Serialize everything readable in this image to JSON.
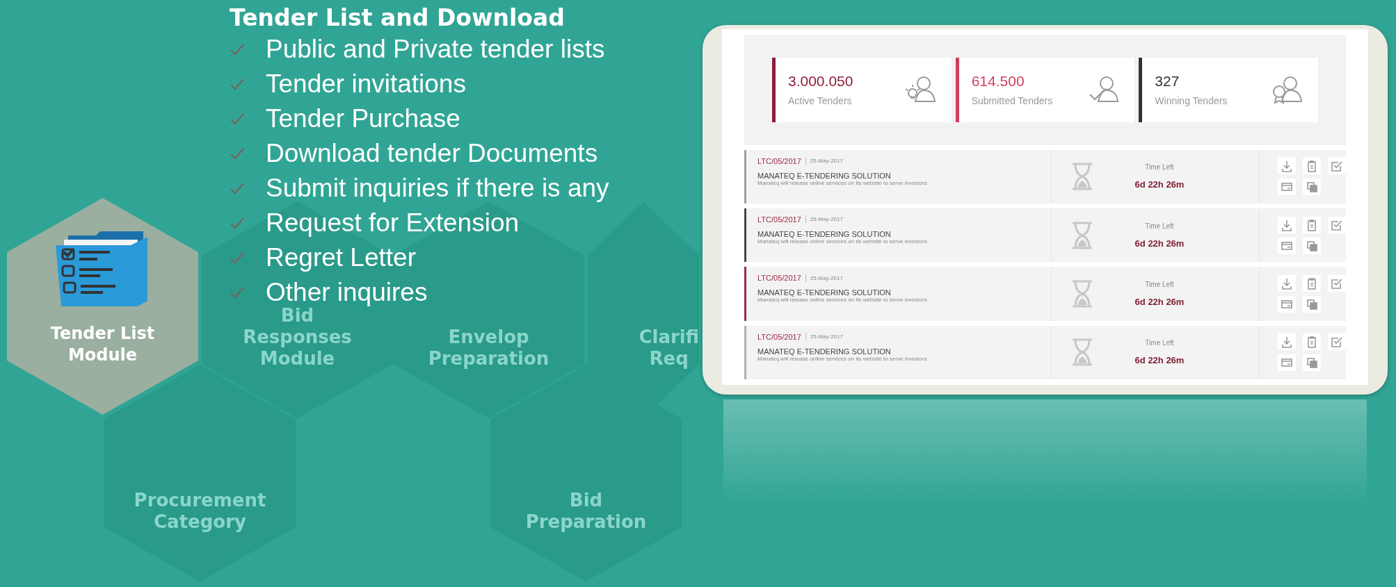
{
  "slide": {
    "heading": "Tender List and Download",
    "features": [
      "Public and Private tender lists",
      "Tender invitations",
      "Tender Purchase",
      "Download tender Documents",
      "Submit inquiries if there is any",
      "Request for Extension",
      "Regret Letter",
      "Other inquires"
    ]
  },
  "modules": [
    {
      "lines": [
        "Tender List",
        "Module"
      ],
      "selected": true
    },
    {
      "lines": [
        "Bid",
        "Responses",
        "Module"
      ],
      "selected": false
    },
    {
      "lines": [
        "Envelop",
        "Preparation"
      ],
      "selected": false
    },
    {
      "lines": [
        "Clarifi",
        "Req"
      ],
      "selected": false
    },
    {
      "lines": [
        "Procurement",
        "Category"
      ],
      "selected": false
    },
    {
      "lines": [
        "Bid",
        "Preparation"
      ],
      "selected": false
    }
  ],
  "dashboard": {
    "stats": [
      {
        "value": "3.000.050",
        "label": "Active Tenders",
        "color": "#8a2038",
        "kind": "active"
      },
      {
        "value": "614.500",
        "label": "Submitted Tenders",
        "color": "#cf3f5c",
        "kind": "submitted"
      },
      {
        "value": "327",
        "label": "Winning Tenders",
        "color": "#333333",
        "kind": "winning"
      }
    ],
    "tenders": [
      {
        "ref": "LTC/05/2017",
        "date": "25-May-2017",
        "title": "MANATEQ E-TENDERING SOLUTION",
        "description": "Manateq will release online services on its website to serve investors",
        "time_label": "Time Left",
        "time_left": "6d 22h 26m",
        "color": "#9e9e9e"
      },
      {
        "ref": "LTC/05/2017",
        "date": "25-May-2017",
        "title": "MANATEQ E-TENDERING SOLUTION",
        "description": "Manateq will release online services on its website to serve investors",
        "time_label": "Time Left",
        "time_left": "6d 22h 26m",
        "color": "#444444"
      },
      {
        "ref": "LTC/05/2017",
        "date": "25-May-2017",
        "title": "MANATEQ E-TENDERING SOLUTION",
        "description": "Manateq will release online services on its website to serve investors",
        "time_label": "Time Left",
        "time_left": "6d 22h 26m",
        "color": "#9a2a42"
      },
      {
        "ref": "LTC/05/2017",
        "date": "25-May-2017",
        "title": "MANATEQ E-TENDERING SOLUTION",
        "description": "Manateq will release online services on its website to serve investors",
        "time_label": "Time Left",
        "time_left": "6d 22h 26m",
        "color": "#b0b0b0"
      }
    ]
  }
}
